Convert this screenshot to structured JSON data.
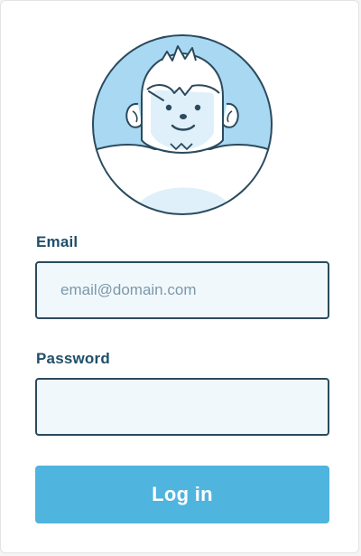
{
  "form": {
    "email_label": "Email",
    "email_placeholder": "email@domain.com",
    "email_value": "",
    "password_label": "Password",
    "password_placeholder": "",
    "password_value": "",
    "login_label": "Log in"
  },
  "colors": {
    "label": "#1f4f6b",
    "input_border": "#2b4a5d",
    "input_background": "#f1f8fc",
    "button_background": "#4fb4de",
    "button_text": "#ffffff",
    "avatar_background": "#a8d8f2"
  },
  "icons": {
    "avatar": "yeti-avatar-icon"
  }
}
